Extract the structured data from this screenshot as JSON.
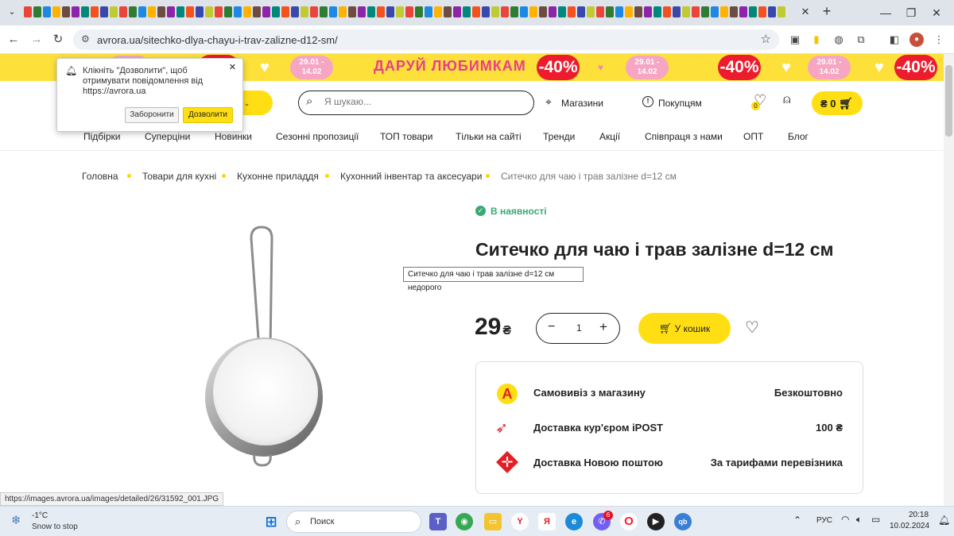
{
  "browser": {
    "url": "avrora.ua/sitechko-dlya-chayu-i-trav-zalizne-d12-sm/",
    "status_url": "https://images.avrora.ua/images/detailed/26/31592_001.JPG"
  },
  "banner": {
    "date_range": "29.01 -\n14.02",
    "promo_text": "ДАРУЙ ЛЮБИМКАМ",
    "discount": "-40%",
    "colors": {
      "background": "#fde13a",
      "pink": "#f6a6c2",
      "red": "#ec1b2d",
      "promo": "#e83e8c"
    }
  },
  "notification_popup": {
    "text": "Клікніть \"Дозволити\", щоб отримувати повідомлення від https://avrora.ua",
    "deny_label": "Заборонити",
    "allow_label": "Дозволити"
  },
  "header": {
    "catalog_label": "ри",
    "search_placeholder": "Я шукаю...",
    "stores_label": "Магазини",
    "buyers_label": "Покупцям",
    "wishlist_count": "0",
    "cart_label": "₴ 0"
  },
  "menu": [
    "Підбірки",
    "Суперціни",
    "Новинки",
    "Сезонні пропозиції",
    "ТОП товари",
    "Тільки на сайті",
    "Тренди",
    "Акції",
    "Співпраця з нами",
    "ОПТ",
    "Блог"
  ],
  "breadcrumb": [
    "Головна",
    "Товари для кухні",
    "Кухонне приладдя",
    "Кухонний інвентар та аксесуари",
    "Ситечко для чаю і трав залізне d=12 см"
  ],
  "product": {
    "availability": "В наявності",
    "title": "Ситечко для чаю і трав залізне d=12 см",
    "tooltip": "Ситечко для чаю і трав залізне d=12 см недорого",
    "price": "29",
    "currency": "₴",
    "quantity": "1",
    "add_to_cart": "У кошик"
  },
  "delivery": [
    {
      "icon": "avrora-store-icon",
      "label": "Самовивіз з магазину",
      "value": "Безкоштовно"
    },
    {
      "icon": "ipost-courier-icon",
      "label": "Доставка кур'єром iPOST",
      "value": "100 ₴"
    },
    {
      "icon": "nova-poshta-icon",
      "label": "Доставка Новою поштою",
      "value": "За тарифами перевізника"
    }
  ],
  "taskbar": {
    "weather_temp": "-1°C",
    "weather_text": "Snow to stop",
    "search_label": "Поиск",
    "language": "РУС",
    "time": "20:18",
    "date": "10.02.2024",
    "viber_badge": "6"
  },
  "colors": {
    "accent": "#ffdf13",
    "instock": "#3aa876"
  }
}
